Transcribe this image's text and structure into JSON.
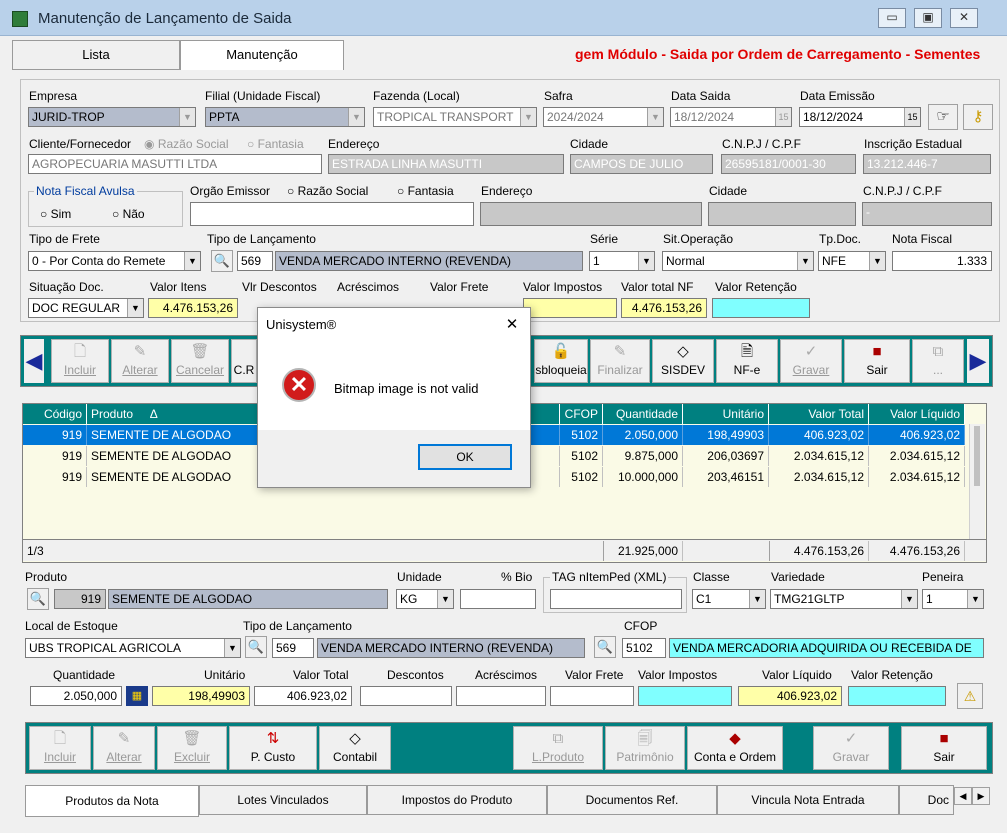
{
  "window": {
    "title": "Manutenção de Lançamento de Saida"
  },
  "tabs": {
    "lista": "Lista",
    "manutencao": "Manutenção"
  },
  "module_title": "gem Módulo - Saida por Ordem de Carregamento - Sementes",
  "header": {
    "empresa_label": "Empresa",
    "empresa_value": "JURID-TROP",
    "filial_label": "Filial (Unidade Fiscal)",
    "filial_value": "PPTA",
    "fazenda_label": "Fazenda (Local)",
    "fazenda_value": "TROPICAL TRANSPORT",
    "safra_label": "Safra",
    "safra_value": "2024/2024",
    "data_saida_label": "Data Saida",
    "data_saida_value": "18/12/2024",
    "data_emissao_label": "Data Emissão",
    "data_emissao_value": "18/12/2024",
    "cliente_label": "Cliente/Fornecedor",
    "razao_social": "Razão Social",
    "fantasia": "Fantasia",
    "cliente_value": "AGROPECUARIA MASUTTI LTDA",
    "endereco_label": "Endereço",
    "endereco_value": "ESTRADA LINHA MASUTTI",
    "cidade_label": "Cidade",
    "cidade_value": "CAMPOS DE JULIO",
    "cnpj_label": "C.N.P.J / C.P.F",
    "cnpj_value": "26595181/0001-30",
    "ie_label": "Inscrição Estadual",
    "ie_value": "13.212.446-7",
    "nf_avulsa_label": "Nota Fiscal Avulsa",
    "sim": "Sim",
    "nao": "Não",
    "orgao_label": "Orgão Emissor",
    "orgao_razao": "Razão Social",
    "orgao_fantasia": "Fantasia",
    "orgao_endereco_label": "Endereço",
    "orgao_cidade_label": "Cidade",
    "orgao_cnpj_label": "C.N.P.J / C.P.F",
    "orgao_cnpj_value": "-",
    "tipo_frete_label": "Tipo de Frete",
    "tipo_frete_value": "0 - Por Conta do Remete",
    "tipo_lanc_label": "Tipo de Lançamento",
    "tipo_lanc_code": "569",
    "tipo_lanc_desc": "VENDA MERCADO INTERNO (REVENDA)",
    "serie_label": "Série",
    "serie_value": "1",
    "sit_op_label": "Sit.Operação",
    "sit_op_value": "Normal",
    "tpdoc_label": "Tp.Doc.",
    "tpdoc_value": "NFE",
    "nota_label": "Nota Fiscal",
    "nota_value": "1.333",
    "situacao_label": "Situação Doc.",
    "situacao_value": "DOC REGULAR",
    "valor_itens_label": "Valor Itens",
    "valor_itens_value": "4.476.153,26",
    "vlr_desc_label": "Vlr Descontos",
    "acrescimos_label": "Acréscimos",
    "valor_frete_label": "Valor Frete",
    "valor_impostos_label": "Valor Impostos",
    "valor_total_label": "Valor total NF",
    "valor_total_value": "4.476.153,26",
    "valor_retencao_label": "Valor Retenção"
  },
  "toolbar1": {
    "incluir": "Incluir",
    "alterar": "Alterar",
    "cancelar": "Cancelar",
    "cr": "C.R",
    "desbloqueia": "sbloqueia",
    "finalizar": "Finalizar",
    "sisdev": "SISDEV",
    "nfe": "NF-e",
    "gravar": "Gravar",
    "sair": "Sair",
    "more": "..."
  },
  "grid": {
    "headers": [
      "Código",
      "Produto",
      "CFOP",
      "Quantidade",
      "Unitário",
      "Valor Total",
      "Valor Líquido"
    ],
    "rows": [
      {
        "codigo": "919",
        "produto": "SEMENTE DE ALGODAO",
        "cfop": "5102",
        "quantidade": "2.050,000",
        "unitario": "198,49903",
        "total": "406.923,02",
        "liquido": "406.923,02"
      },
      {
        "codigo": "919",
        "produto": "SEMENTE DE ALGODAO",
        "cfop": "5102",
        "quantidade": "9.875,000",
        "unitario": "206,03697",
        "total": "2.034.615,12",
        "liquido": "2.034.615,12"
      },
      {
        "codigo": "919",
        "produto": "SEMENTE DE ALGODAO",
        "cfop": "5102",
        "quantidade": "10.000,000",
        "unitario": "203,46151",
        "total": "2.034.615,12",
        "liquido": "2.034.615,12"
      }
    ],
    "footer_count": "1/3",
    "footer_qtd": "21.925,000",
    "footer_total": "4.476.153,26",
    "footer_liquido": "4.476.153,26"
  },
  "detail": {
    "produto_label": "Produto",
    "produto_code": "919",
    "produto_desc": "SEMENTE DE ALGODAO",
    "unidade_label": "Unidade",
    "unidade_value": "KG",
    "bio_label": "% Bio",
    "tag_label": "TAG nItemPed (XML)",
    "classe_label": "Classe",
    "classe_value": "C1",
    "variedade_label": "Variedade",
    "variedade_value": "TMG21GLTP",
    "peneira_label": "Peneira",
    "peneira_value": "1",
    "local_label": "Local de Estoque",
    "local_value": "UBS TROPICAL AGRICOLA",
    "tipo_lanc_label": "Tipo de Lançamento",
    "tipo_lanc_code": "569",
    "tipo_lanc_desc": "VENDA MERCADO INTERNO (REVENDA)",
    "cfop_label": "CFOP",
    "cfop_code": "5102",
    "cfop_desc": "VENDA MERCADORIA ADQUIRIDA OU RECEBIDA DE",
    "quantidade_label": "Quantidade",
    "quantidade_value": "2.050,000",
    "unitario_label": "Unitário",
    "unitario_value": "198,49903",
    "valor_total_label": "Valor Total",
    "valor_total_value": "406.923,02",
    "descontos_label": "Descontos",
    "acrescimos_label": "Acréscimos",
    "valor_frete_label": "Valor Frete",
    "valor_impostos_label": "Valor Impostos",
    "valor_liquido_label": "Valor Líquido",
    "valor_liquido_value": "406.923,02",
    "valor_retencao_label": "Valor Retenção"
  },
  "toolbar2": {
    "incluir": "Incluir",
    "alterar": "Alterar",
    "excluir": "Excluir",
    "pcusto": "P. Custo",
    "contabil": "Contabil",
    "lproduto": "L.Produto",
    "patrimonio": "Patrimônio",
    "conta_ordem": "Conta e Ordem",
    "gravar": "Gravar",
    "sair": "Sair"
  },
  "bottom_tabs": [
    "Produtos da Nota",
    "Lotes Vinculados",
    "Impostos do Produto",
    "Documentos Ref.",
    "Vincula Nota Entrada",
    "Doc"
  ],
  "dialog": {
    "title": "Unisystem®",
    "message": "Bitmap image is not valid",
    "ok": "OK",
    "close": "✕"
  }
}
